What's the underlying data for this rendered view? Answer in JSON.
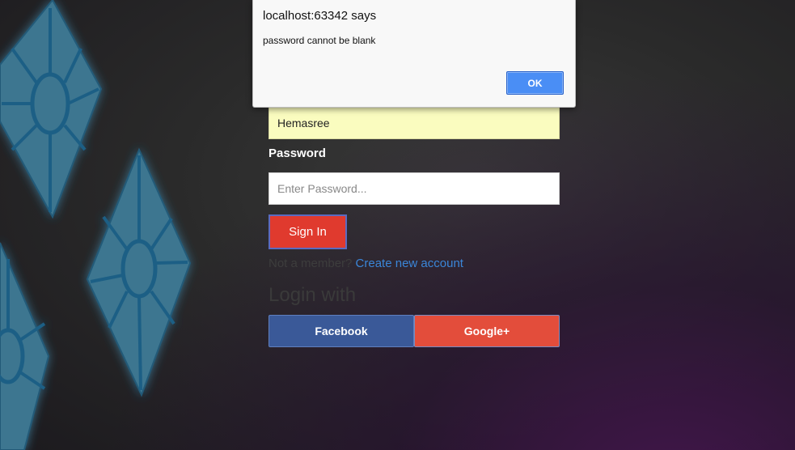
{
  "colors": {
    "accent_blue": "#4a8ef5",
    "signin_red": "#e03a2e",
    "facebook_blue": "#3a5998",
    "google_red": "#e34d3b",
    "link_blue": "#3b86d8",
    "username_fill": "#fafcbf"
  },
  "dialog": {
    "title": "localhost:63342 says",
    "message": "password cannot be blank",
    "ok_label": "OK"
  },
  "form": {
    "username_value": "Hemasree",
    "password_label": "Password",
    "password_placeholder": "Enter Password...",
    "signin_label": "Sign In",
    "not_member_text": "Not a member?",
    "create_account_label": "Create new account",
    "login_with_heading": "Login with",
    "facebook_label": "Facebook",
    "google_label": "Google+"
  },
  "background": {
    "decoration": "diamond-gem-icon"
  }
}
